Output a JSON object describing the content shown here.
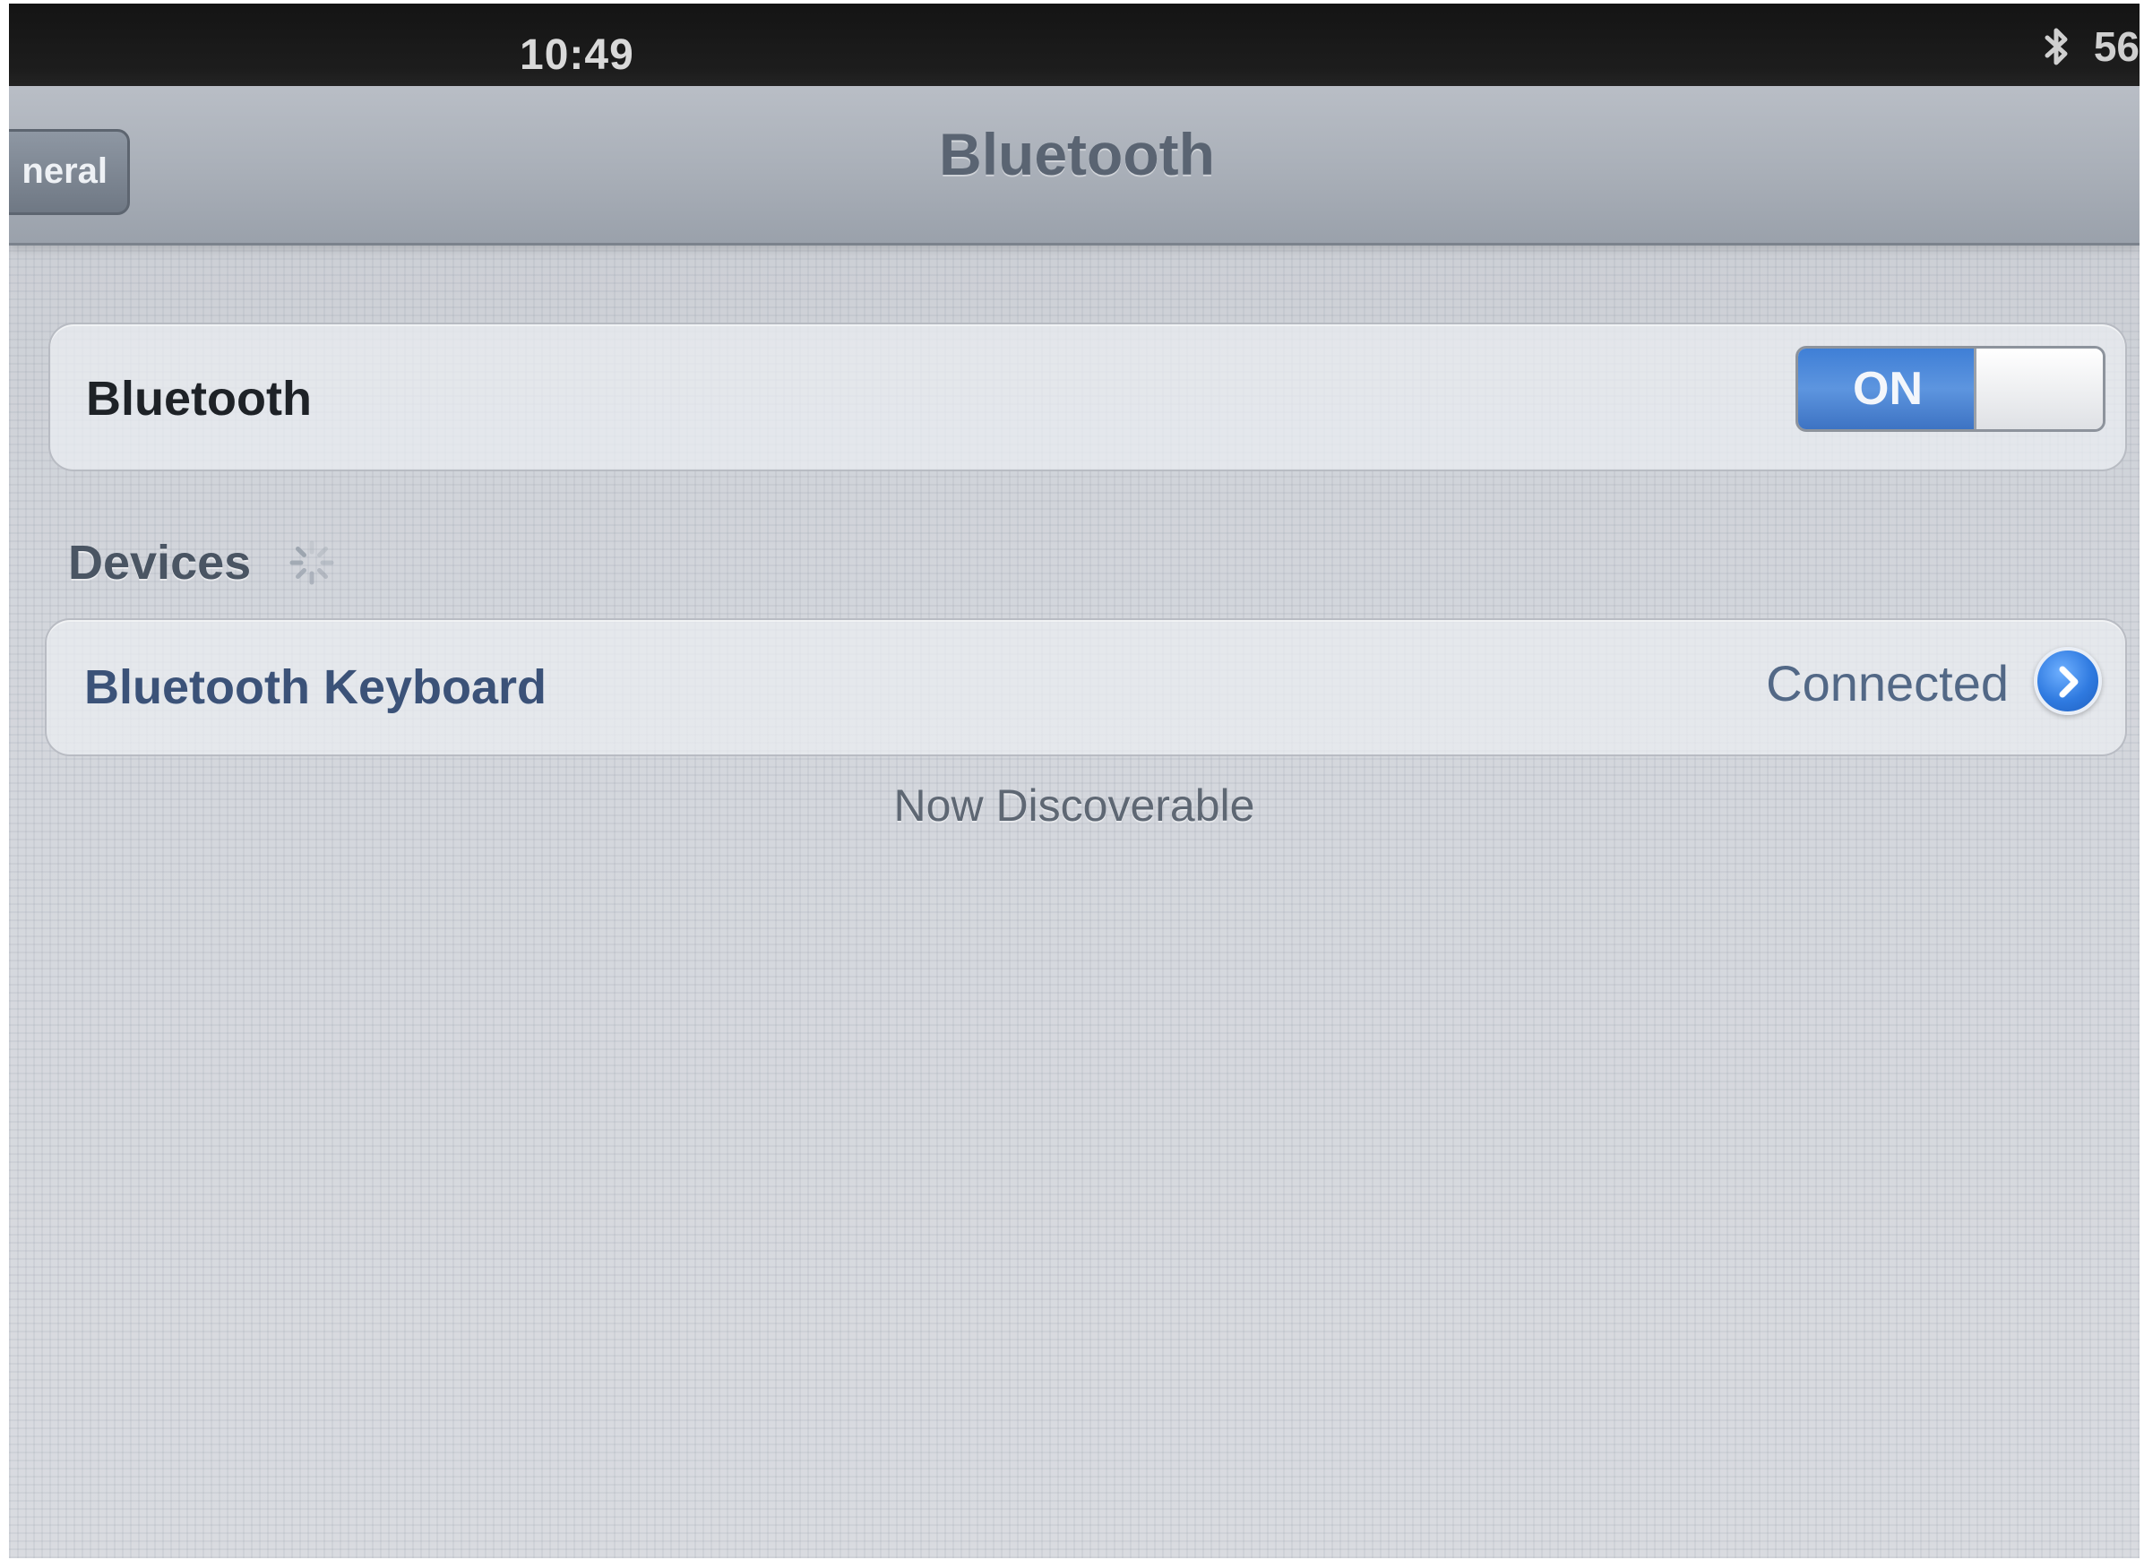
{
  "status_bar": {
    "time": "10:49",
    "bluetooth_icon": "bluetooth-icon",
    "battery_text": "56"
  },
  "nav_bar": {
    "back_label": "neral",
    "title": "Bluetooth"
  },
  "bluetooth_setting": {
    "label": "Bluetooth",
    "toggle_state": "ON",
    "toggle_on": true,
    "accent_color": "#3f7fd6"
  },
  "devices_section": {
    "header": "Devices",
    "spinner_icon": "loading-spinner-icon",
    "items": [
      {
        "name": "Bluetooth Keyboard",
        "status": "Connected",
        "accessory_icon": "disclosure-chevron-icon"
      }
    ]
  },
  "footer": {
    "text": "Now Discoverable"
  }
}
